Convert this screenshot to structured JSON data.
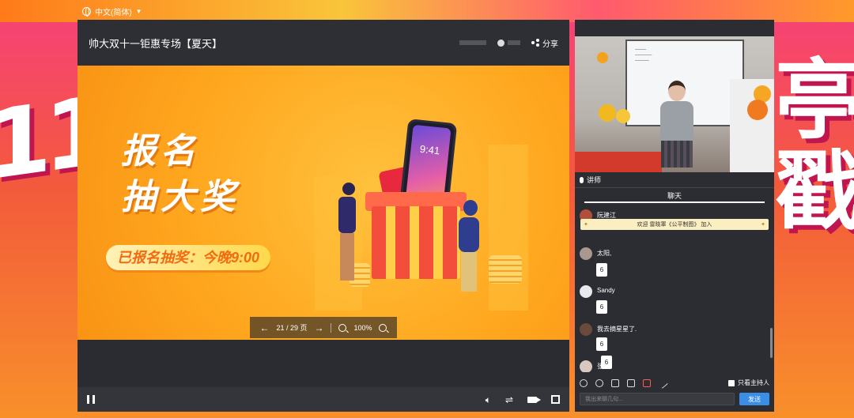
{
  "language": {
    "label": "中文(简体)"
  },
  "background": {
    "left_glyphs": "11",
    "right_glyphs": "亭戳"
  },
  "player": {
    "title": "帅大双十一钜惠专场【夏天】",
    "share_label": "分享",
    "slide": {
      "headline_line1": "报名",
      "headline_line2": "抽大奖",
      "pill": "已报名抽奖：今晚9:00",
      "phone_time": "9:41"
    },
    "pager": {
      "page_text": "21 / 29 页",
      "zoom_text": "100%"
    }
  },
  "side": {
    "speaker_label": "讲师",
    "chat_tab": "聊天",
    "notice": "欢迎 雷晓軍《公平制图》 加入",
    "messages": [
      {
        "name": "阮建江",
        "text": ""
      },
      {
        "name": "太阳,",
        "text": "6"
      },
      {
        "name": "Sandy",
        "text": "6"
      },
      {
        "name": "我去摘星星了.",
        "text": "6"
      },
      {
        "name": "张萍",
        "text": "6"
      }
    ],
    "host_only_label": "只看主持人",
    "input_placeholder": "我出来聊几句...",
    "send_label": "发送"
  },
  "colors": {
    "accent": "#3a8ee6",
    "panel": "#2c2d32",
    "slide_orange": "#ffa71f"
  }
}
